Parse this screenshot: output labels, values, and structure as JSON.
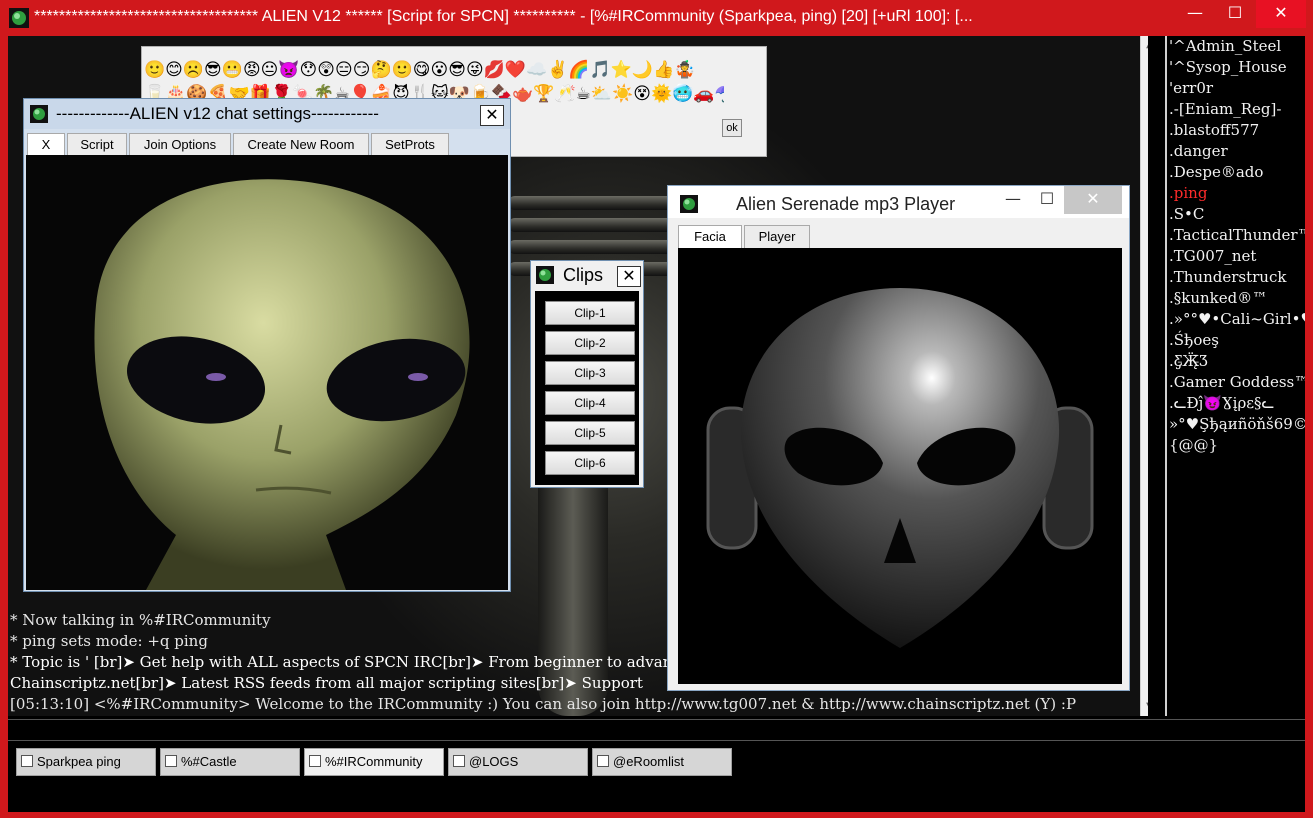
{
  "window": {
    "title": "************************************ ALIEN V12 ****** [Script for SPCN] ********** - [%#IRCommunity (Sparkpea, ping) [20] [+uRl 100]: [...",
    "minimize_label": "—",
    "maximize_label": "☐",
    "close_label": "✕"
  },
  "colors": {
    "titlebar": "#d0181c",
    "nick_highlight": "#ff2b2b",
    "chat_text": "#e6e6e6"
  },
  "emoticons": {
    "row1": "🙂😊☹️😎😬😡😐👿😯😲😑😏🤔🙂😋😮😎😜💋❤️☁️✌️🌈🎵⭐🌙👍🤹",
    "row2": "🥛🎂🍪🍕🤝🎁🌹🍬🌴☕🎈🍰😈🍴🐱🐶🍺🍫🫖🏆🥂☕⛅☀️😵🌞🥶🚗☂️🎂🍸🌏😆",
    "ok_label": "ok"
  },
  "settings_dialog": {
    "title": "-------------ALIEN v12 chat settings------------",
    "close_label": "✕",
    "tabs": [
      {
        "label": "X"
      },
      {
        "label": "Script"
      },
      {
        "label": "Join Options"
      },
      {
        "label": "Create New Room"
      },
      {
        "label": "SetProts"
      }
    ]
  },
  "clips": {
    "title": "Clips",
    "close_label": "✕",
    "buttons": [
      "Clip-1",
      "Clip-2",
      "Clip-3",
      "Clip-4",
      "Clip-5",
      "Clip-6"
    ]
  },
  "player": {
    "title": "Alien Serenade mp3 Player",
    "minimize_label": "—",
    "maximize_label": "☐",
    "close_label": "✕",
    "tabs": [
      {
        "label": "Facia"
      },
      {
        "label": "Player"
      }
    ]
  },
  "chat": {
    "lines": [
      "* Now talking in %#IRCommunity",
      "* ping sets mode: +q ping",
      "* Topic is ' [br]➤ Get help with ALL aspects of SPCN IRC[br]➤ From beginner to advan",
      "   Chainscriptz.net[br]➤ Latest RSS feeds from all major scripting sites[br]➤ Support",
      "[05:13:10] <%#IRCommunity> Welcome to the IRCommunity :) You can also join http://www.tg007.net & http://www.chainscriptz.net (Y) :P"
    ]
  },
  "nicklist": [
    {
      "nick": "'^Admin_Steel"
    },
    {
      "nick": "'^Sysop_House"
    },
    {
      "nick": "'err0r"
    },
    {
      "nick": ".-[Eniam_Reg]-"
    },
    {
      "nick": ".blastoff577"
    },
    {
      "nick": ".danger"
    },
    {
      "nick": ".Despe®ado"
    },
    {
      "nick": ".ping",
      "highlight": true
    },
    {
      "nick": ".S•C"
    },
    {
      "nick": ".TacticalThunder™"
    },
    {
      "nick": ".TG007_net"
    },
    {
      "nick": ".Thunderstruck"
    },
    {
      "nick": ".§kunked®™"
    },
    {
      "nick": ".»°°♥•Cali~Girl•♥°"
    },
    {
      "nick": ".Śђoeş"
    },
    {
      "nick": ".Ƹ̵̡Ӝ̵̨̄Ʒ"
    },
    {
      "nick": ".Gamer Goddess™"
    },
    {
      "nick": ".ᓚĐĵ😈Ɣįρε§ᓚ"
    },
    {
      "nick": "»°♥Şђąиñöňš69©"
    },
    {
      "nick": "{@@}"
    }
  ],
  "switchbar": [
    {
      "label": "Sparkpea ping",
      "active": false
    },
    {
      "label": "%#Castle",
      "active": false
    },
    {
      "label": "%#IRCommunity",
      "active": true
    },
    {
      "label": "@LOGS",
      "active": false
    },
    {
      "label": "@eRoomlist",
      "active": false
    }
  ]
}
